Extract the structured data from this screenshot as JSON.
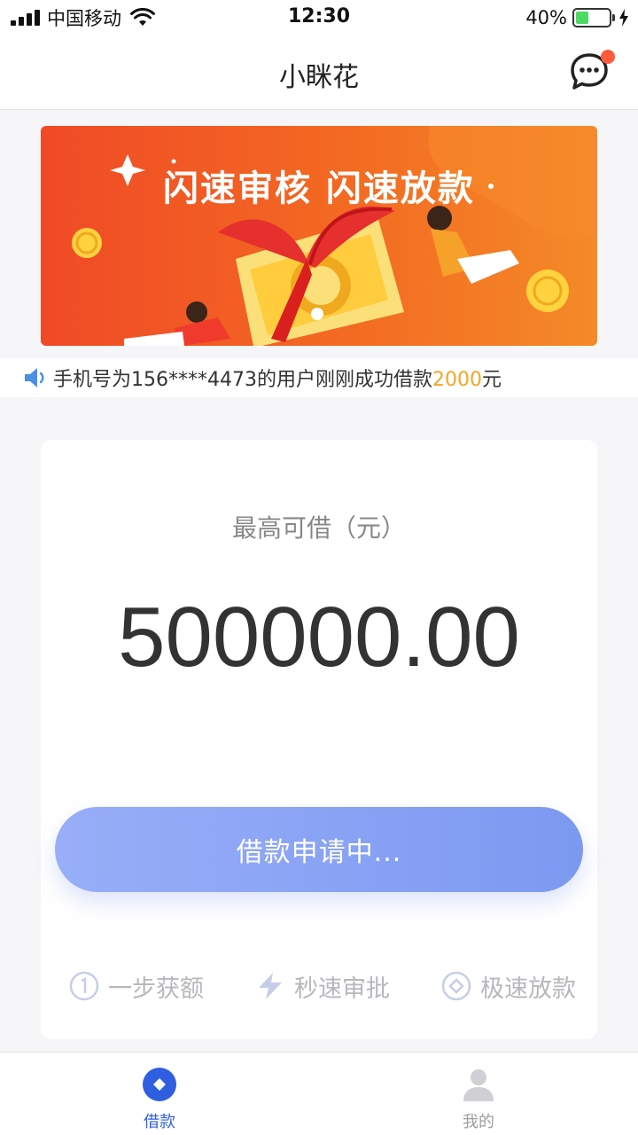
{
  "status_bar": {
    "carrier": "中国移动",
    "time": "12:30",
    "battery_percent": "40%",
    "battery_level": 0.4
  },
  "nav": {
    "title": "小眯花"
  },
  "banner": {
    "slogan": "闪速审核 闪速放款"
  },
  "ticker": {
    "prefix": "手机号为156****4473的用户刚刚成功借款",
    "amount": "2000",
    "suffix": "元"
  },
  "card": {
    "label": "最高可借（元）",
    "amount": "500000.00",
    "apply_button": "借款申请中...",
    "features": [
      {
        "icon": "number-one-icon",
        "label": "一步获额"
      },
      {
        "icon": "lightning-icon",
        "label": "秒速审批"
      },
      {
        "icon": "diamond-icon",
        "label": "极速放款"
      }
    ]
  },
  "tabbar": {
    "items": [
      {
        "icon": "loan-icon",
        "label": "借款",
        "active": true
      },
      {
        "icon": "user-icon",
        "label": "我的",
        "active": false
      }
    ]
  },
  "colors": {
    "accent": "#2f5fe0",
    "button_start": "#98aef8",
    "button_end": "#7c99f1",
    "highlight": "#f5a623",
    "badge": "#ff5a3c"
  }
}
